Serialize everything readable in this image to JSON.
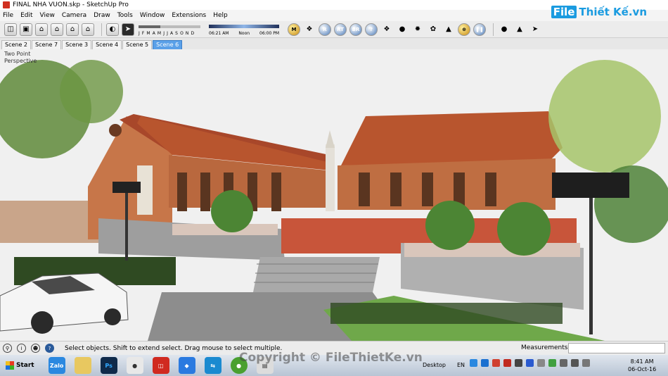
{
  "window": {
    "title": "FINAL NHA VUON.skp - SketchUp Pro"
  },
  "menu": [
    "File",
    "Edit",
    "View",
    "Camera",
    "Draw",
    "Tools",
    "Window",
    "Extensions",
    "Help"
  ],
  "toolbar": {
    "left_tools": [
      "camera-standard-view-icon",
      "iso-view-icon",
      "top-view-icon",
      "front-view-icon",
      "right-view-icon",
      "back-view-icon",
      "left-view-icon"
    ],
    "shadow": {
      "months": "J F M A M J J A S O N D",
      "month_level": 0.35
    },
    "time": {
      "start": "06:21 AM",
      "noon": "Noon",
      "end": "06:00 PM"
    },
    "plugins": [
      "M",
      "",
      "R",
      "RT",
      "BR",
      "?",
      "",
      "",
      "",
      "",
      "",
      "",
      ""
    ]
  },
  "logo": {
    "box": "File",
    "text": "Thiết Kế.vn"
  },
  "scenes": [
    "Scene 2",
    "Scene 7",
    "Scene 3",
    "Scene 4",
    "Scene 5",
    "Scene 6"
  ],
  "active_scene": "Scene 6",
  "viewport": {
    "label_line1": "Two Point",
    "label_line2": "Perspective"
  },
  "status": {
    "text": "Select objects. Shift to extend select. Drag mouse to select multiple.",
    "measurements_label": "Measurements"
  },
  "taskbar": {
    "start": "Start",
    "apps": [
      "Zalo",
      "",
      "Ps",
      "",
      "",
      "",
      "",
      "",
      ""
    ],
    "desktop": "Desktop",
    "lang": "EN",
    "time": "8:41 AM",
    "date": "06-Oct-16"
  },
  "watermark": "Copyright © FileThietKe.vn",
  "colors": {
    "accent": "#1a9be0",
    "roof": "#b8552e",
    "brick": "#c77649",
    "active_tab": "#5aa0e8"
  }
}
